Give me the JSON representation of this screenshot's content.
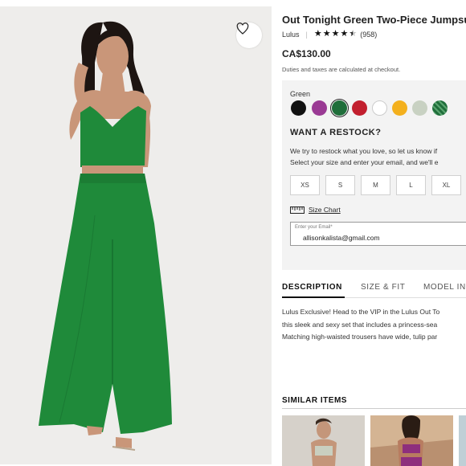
{
  "product": {
    "title": "Out Tonight Green Two-Piece Jumpsuit",
    "brand": "Lulus",
    "rating": 4.5,
    "review_count": "(958)",
    "price": "CA$130.00",
    "duties_note": "Duties and taxes are calculated at checkout.",
    "image_alt": "Model wearing green crop top and wide-leg trousers"
  },
  "colors": {
    "label": "Green",
    "swatches": [
      {
        "name": "black-swatch",
        "hex": "#111111"
      },
      {
        "name": "purple-swatch",
        "hex": "#9a3a94"
      },
      {
        "name": "green-swatch",
        "hex": "#1f6e3a",
        "selected": true
      },
      {
        "name": "red-swatch",
        "hex": "#c21f2e"
      },
      {
        "name": "white-swatch",
        "hex": "#ffffff"
      },
      {
        "name": "mustard-swatch",
        "hex": "#f3b01d"
      },
      {
        "name": "sage-swatch",
        "hex": "#c8d1c2"
      },
      {
        "name": "pattern-green-swatch",
        "hex": "#2a7b47"
      }
    ]
  },
  "restock": {
    "heading": "WANT A RESTOCK?",
    "line1": "We try to restock what you love, so let us know if",
    "line2": "Select your size and enter your email, and we'll e"
  },
  "sizes": [
    "XS",
    "S",
    "M",
    "L",
    "XL"
  ],
  "size_chart_label": "Size Chart",
  "email": {
    "label": "Enter your Email*",
    "value": "allisonkalista@gmail.com"
  },
  "tabs": [
    "DESCRIPTION",
    "SIZE & FIT",
    "MODEL IN"
  ],
  "description": {
    "line1": "Lulus Exclusive! Head to the VIP in the Lulus Out To",
    "line2": "this sleek and sexy set that includes a princess-sea",
    "line3": "Matching high-waisted trousers have wide, tulip par"
  },
  "similar_items_heading": "SIMILAR ITEMS",
  "accent_color": "#1f8a3a"
}
